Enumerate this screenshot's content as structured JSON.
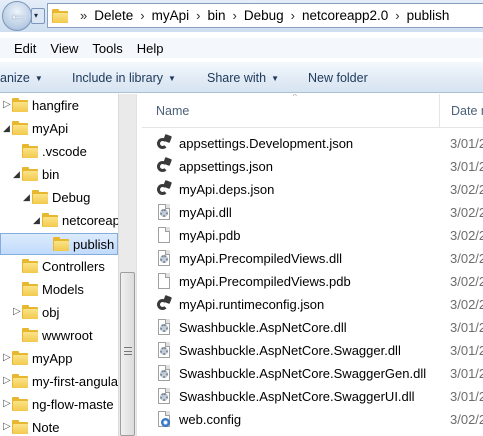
{
  "address": {
    "crumbs": [
      "Delete",
      "myApi",
      "bin",
      "Debug",
      "netcoreapp2.0",
      "publish"
    ],
    "separator": "»",
    "back_glyph": "←",
    "dropdown_glyph": "▾",
    "breadcrumb_separator_glyph": "›"
  },
  "menu": [
    "Edit",
    "View",
    "Tools",
    "Help"
  ],
  "toolbar": {
    "organize_label": "anize",
    "include_label": "Include in library",
    "share_label": "Share with",
    "newfolder_label": "New folder",
    "dropdown_glyph": "▼"
  },
  "nav": {
    "items": [
      {
        "label": "hangfire",
        "expander": "closed"
      },
      {
        "label": "myApi",
        "expander": "open"
      },
      {
        "label": ".vscode",
        "expander": "none"
      },
      {
        "label": "bin",
        "expander": "open"
      },
      {
        "label": "Debug",
        "expander": "open"
      },
      {
        "label": "netcoreap",
        "expander": "open"
      },
      {
        "label": "publish",
        "expander": "none",
        "selected": true
      },
      {
        "label": "Controllers",
        "expander": "none"
      },
      {
        "label": "Models",
        "expander": "none"
      },
      {
        "label": "obj",
        "expander": "closed"
      },
      {
        "label": "wwwroot",
        "expander": "none"
      },
      {
        "label": "myApp",
        "expander": "closed"
      },
      {
        "label": "my-first-angula",
        "expander": "closed"
      },
      {
        "label": "ng-flow-maste",
        "expander": "closed"
      },
      {
        "label": "Note",
        "expander": "closed"
      }
    ],
    "expander_open_glyph": "◢",
    "expander_closed_glyph": "▷"
  },
  "list": {
    "col_name": "Name",
    "col_date": "Date m",
    "sort_glyph": "^",
    "files": [
      {
        "name": "appsettings.Development.json",
        "date": "3/01/2",
        "icon": "json-file-icon"
      },
      {
        "name": "appsettings.json",
        "date": "3/01/2",
        "icon": "json-file-icon"
      },
      {
        "name": "myApi.deps.json",
        "date": "3/02/2",
        "icon": "json-file-icon"
      },
      {
        "name": "myApi.dll",
        "date": "3/02/2",
        "icon": "dll-file-icon"
      },
      {
        "name": "myApi.pdb",
        "date": "3/02/2",
        "icon": "blank-file-icon"
      },
      {
        "name": "myApi.PrecompiledViews.dll",
        "date": "3/02/2",
        "icon": "dll-file-icon"
      },
      {
        "name": "myApi.PrecompiledViews.pdb",
        "date": "3/02/2",
        "icon": "blank-file-icon"
      },
      {
        "name": "myApi.runtimeconfig.json",
        "date": "3/02/2",
        "icon": "json-file-icon"
      },
      {
        "name": "Swashbuckle.AspNetCore.dll",
        "date": "3/01/2",
        "icon": "dll-file-icon"
      },
      {
        "name": "Swashbuckle.AspNetCore.Swagger.dll",
        "date": "3/01/2",
        "icon": "dll-file-icon"
      },
      {
        "name": "Swashbuckle.AspNetCore.SwaggerGen.dll",
        "date": "3/01/2",
        "icon": "dll-file-icon"
      },
      {
        "name": "Swashbuckle.AspNetCore.SwaggerUI.dll",
        "date": "3/01/2",
        "icon": "dll-file-icon"
      },
      {
        "name": "web.config",
        "date": "3/02/2",
        "icon": "config-file-icon"
      }
    ]
  }
}
